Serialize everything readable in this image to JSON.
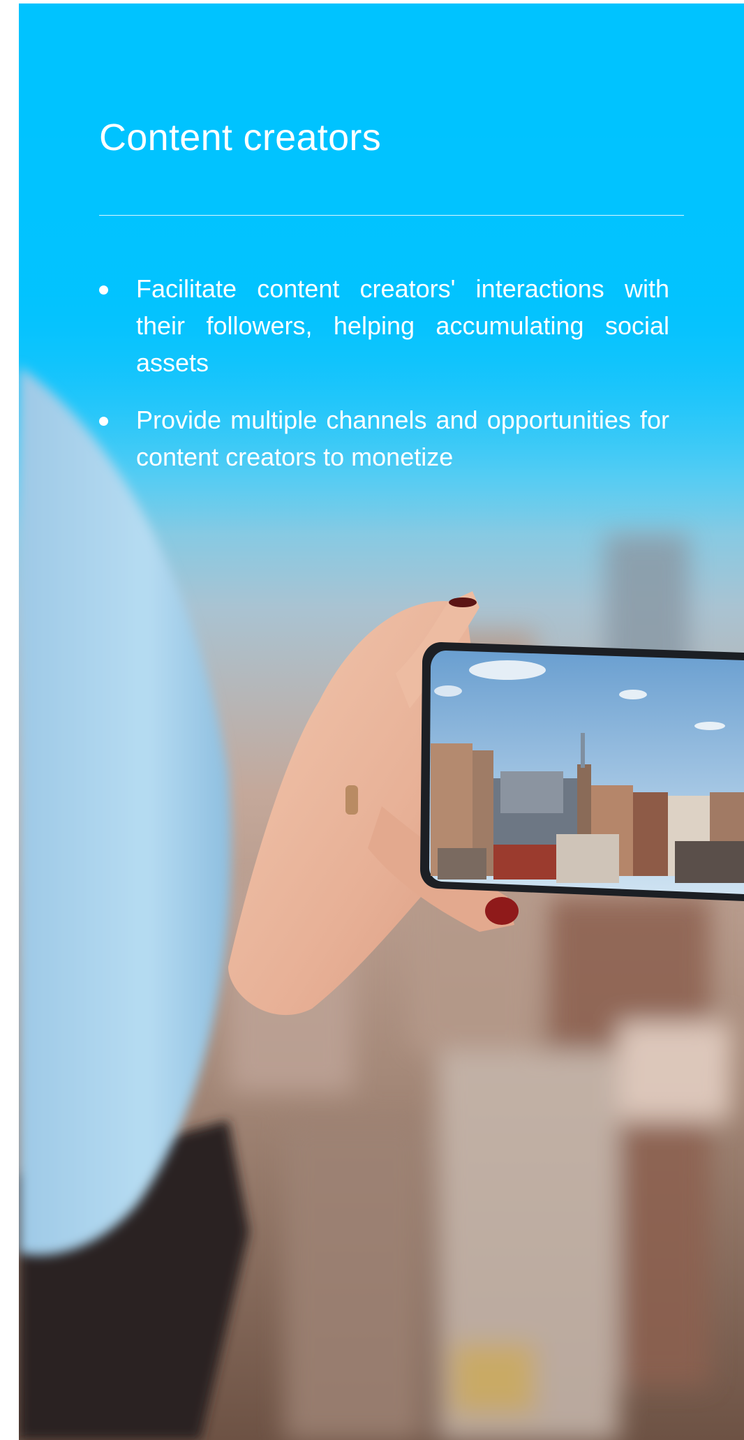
{
  "section": {
    "title": "Content creators",
    "bullets": [
      {
        "text": "Facilitate content creators' interactions with their followers, helping accumulating social assets"
      },
      {
        "text": "Provide multiple channels and opportunities for content creators to monetize"
      }
    ]
  },
  "image": {
    "description_icon": "photo-hand-holding-phone-city-icon"
  },
  "colors": {
    "accent_background": "#00c3ff",
    "text": "#ffffff"
  }
}
